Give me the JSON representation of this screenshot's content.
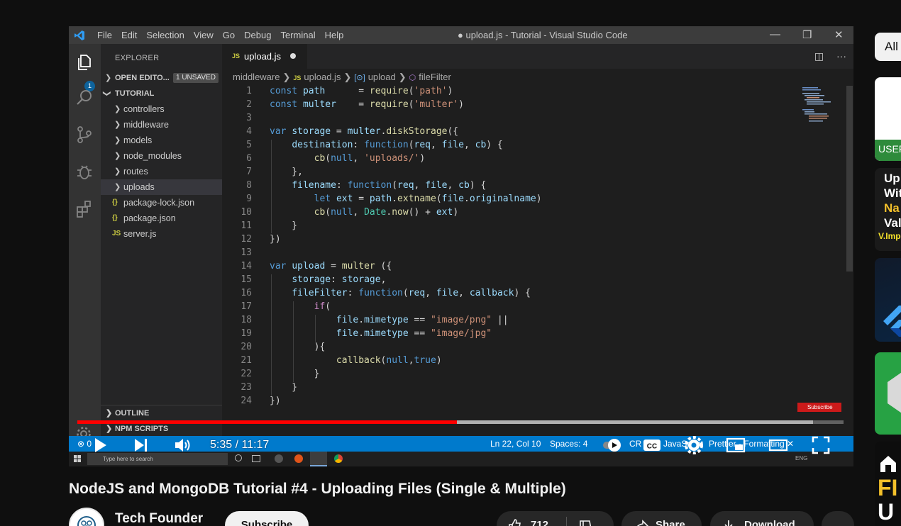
{
  "vscode": {
    "menu": [
      "File",
      "Edit",
      "Selection",
      "View",
      "Go",
      "Debug",
      "Terminal",
      "Help"
    ],
    "window_title": "● upload.js - Tutorial - Visual Studio Code",
    "activity_badge": "1",
    "explorer_title": "EXPLORER",
    "open_editors": "OPEN EDITO...",
    "unsaved_badge": "1 UNSAVED",
    "project": "TUTORIAL",
    "folders": [
      "controllers",
      "middleware",
      "models",
      "node_modules",
      "routes",
      "uploads"
    ],
    "files": [
      {
        "icon": "{}",
        "name": "package-lock.json"
      },
      {
        "icon": "{}",
        "name": "package.json"
      },
      {
        "icon": "JS",
        "name": "server.js"
      }
    ],
    "outline_label": "OUTLINE",
    "npm_label": "NPM SCRIPTS",
    "tab_name": "upload.js",
    "breadcrumb": {
      "folder": "middleware",
      "file": "upload.js",
      "symbol1": "upload",
      "symbol2": "fileFilter"
    },
    "code_lines": [
      {
        "n": "1",
        "t": "const path      = require('path')"
      },
      {
        "n": "2",
        "t": "const multer    = require('multer')"
      },
      {
        "n": "3",
        "t": ""
      },
      {
        "n": "4",
        "t": "var storage = multer.diskStorage({"
      },
      {
        "n": "5",
        "t": "    destination: function(req, file, cb) {"
      },
      {
        "n": "6",
        "t": "        cb(null, 'uploads/')"
      },
      {
        "n": "7",
        "t": "    },"
      },
      {
        "n": "8",
        "t": "    filename: function(req, file, cb) {"
      },
      {
        "n": "9",
        "t": "        let ext = path.extname(file.originalname)"
      },
      {
        "n": "10",
        "t": "        cb(null, Date.now() + ext)"
      },
      {
        "n": "11",
        "t": "    }"
      },
      {
        "n": "12",
        "t": "})"
      },
      {
        "n": "13",
        "t": ""
      },
      {
        "n": "14",
        "t": "var upload = multer ({"
      },
      {
        "n": "15",
        "t": "    storage: storage,"
      },
      {
        "n": "16",
        "t": "    fileFilter: function(req, file, callback) {"
      },
      {
        "n": "17",
        "t": "        if("
      },
      {
        "n": "18",
        "t": "            file.mimetype == \"image/png\" ||"
      },
      {
        "n": "19",
        "t": "            file.mimetype == \"image/jpg\""
      },
      {
        "n": "20",
        "t": "        ){"
      },
      {
        "n": "21",
        "t": "            callback(null,true)"
      },
      {
        "n": "22",
        "t": "        }"
      },
      {
        "n": "23",
        "t": "    }"
      },
      {
        "n": "24",
        "t": "})"
      }
    ],
    "subscribe_badge": "Subscribe",
    "status": {
      "left": "⊗ 0",
      "position": "Ln 22, Col 10",
      "spaces": "Spaces: 4",
      "cr": "CR",
      "lang": "JavaScript",
      "prettier": "Prettier - Formatting ✕"
    },
    "taskbar_search": "Type here to search",
    "taskbar_clock": "ENG"
  },
  "player": {
    "time": "5:35 / 11:17",
    "played_fraction": 0.495,
    "buffered_fraction": 0.96
  },
  "video": {
    "title": "NodeJS and MongoDB Tutorial #4 - Uploading Files (Single & Multiple)",
    "channel": "Tech Founder",
    "subscribe": "Subscribe",
    "likes": "712",
    "share": "Share",
    "download": "Download",
    "more": "..."
  },
  "right_column": {
    "chip_all": "All",
    "thumb1_label": "USER",
    "thumb2_lines": [
      "Up",
      "Wit",
      "Na",
      "Val"
    ],
    "thumb2_sub": "V.Imp",
    "thumb6_lines": [
      "FI",
      "U"
    ]
  },
  "colors": {
    "vscode_status": "#007acc",
    "yt_red": "#ff0000",
    "background": "#0f0f0f"
  }
}
